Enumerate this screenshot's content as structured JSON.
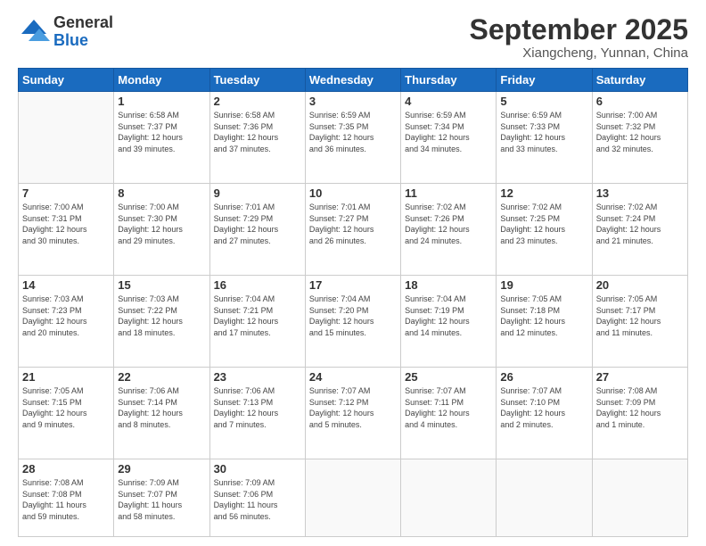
{
  "header": {
    "logo_general": "General",
    "logo_blue": "Blue",
    "title": "September 2025",
    "subtitle": "Xiangcheng, Yunnan, China"
  },
  "days_of_week": [
    "Sunday",
    "Monday",
    "Tuesday",
    "Wednesday",
    "Thursday",
    "Friday",
    "Saturday"
  ],
  "weeks": [
    [
      {
        "day": "",
        "info": ""
      },
      {
        "day": "1",
        "info": "Sunrise: 6:58 AM\nSunset: 7:37 PM\nDaylight: 12 hours\nand 39 minutes."
      },
      {
        "day": "2",
        "info": "Sunrise: 6:58 AM\nSunset: 7:36 PM\nDaylight: 12 hours\nand 37 minutes."
      },
      {
        "day": "3",
        "info": "Sunrise: 6:59 AM\nSunset: 7:35 PM\nDaylight: 12 hours\nand 36 minutes."
      },
      {
        "day": "4",
        "info": "Sunrise: 6:59 AM\nSunset: 7:34 PM\nDaylight: 12 hours\nand 34 minutes."
      },
      {
        "day": "5",
        "info": "Sunrise: 6:59 AM\nSunset: 7:33 PM\nDaylight: 12 hours\nand 33 minutes."
      },
      {
        "day": "6",
        "info": "Sunrise: 7:00 AM\nSunset: 7:32 PM\nDaylight: 12 hours\nand 32 minutes."
      }
    ],
    [
      {
        "day": "7",
        "info": "Sunrise: 7:00 AM\nSunset: 7:31 PM\nDaylight: 12 hours\nand 30 minutes."
      },
      {
        "day": "8",
        "info": "Sunrise: 7:00 AM\nSunset: 7:30 PM\nDaylight: 12 hours\nand 29 minutes."
      },
      {
        "day": "9",
        "info": "Sunrise: 7:01 AM\nSunset: 7:29 PM\nDaylight: 12 hours\nand 27 minutes."
      },
      {
        "day": "10",
        "info": "Sunrise: 7:01 AM\nSunset: 7:27 PM\nDaylight: 12 hours\nand 26 minutes."
      },
      {
        "day": "11",
        "info": "Sunrise: 7:02 AM\nSunset: 7:26 PM\nDaylight: 12 hours\nand 24 minutes."
      },
      {
        "day": "12",
        "info": "Sunrise: 7:02 AM\nSunset: 7:25 PM\nDaylight: 12 hours\nand 23 minutes."
      },
      {
        "day": "13",
        "info": "Sunrise: 7:02 AM\nSunset: 7:24 PM\nDaylight: 12 hours\nand 21 minutes."
      }
    ],
    [
      {
        "day": "14",
        "info": "Sunrise: 7:03 AM\nSunset: 7:23 PM\nDaylight: 12 hours\nand 20 minutes."
      },
      {
        "day": "15",
        "info": "Sunrise: 7:03 AM\nSunset: 7:22 PM\nDaylight: 12 hours\nand 18 minutes."
      },
      {
        "day": "16",
        "info": "Sunrise: 7:04 AM\nSunset: 7:21 PM\nDaylight: 12 hours\nand 17 minutes."
      },
      {
        "day": "17",
        "info": "Sunrise: 7:04 AM\nSunset: 7:20 PM\nDaylight: 12 hours\nand 15 minutes."
      },
      {
        "day": "18",
        "info": "Sunrise: 7:04 AM\nSunset: 7:19 PM\nDaylight: 12 hours\nand 14 minutes."
      },
      {
        "day": "19",
        "info": "Sunrise: 7:05 AM\nSunset: 7:18 PM\nDaylight: 12 hours\nand 12 minutes."
      },
      {
        "day": "20",
        "info": "Sunrise: 7:05 AM\nSunset: 7:17 PM\nDaylight: 12 hours\nand 11 minutes."
      }
    ],
    [
      {
        "day": "21",
        "info": "Sunrise: 7:05 AM\nSunset: 7:15 PM\nDaylight: 12 hours\nand 9 minutes."
      },
      {
        "day": "22",
        "info": "Sunrise: 7:06 AM\nSunset: 7:14 PM\nDaylight: 12 hours\nand 8 minutes."
      },
      {
        "day": "23",
        "info": "Sunrise: 7:06 AM\nSunset: 7:13 PM\nDaylight: 12 hours\nand 7 minutes."
      },
      {
        "day": "24",
        "info": "Sunrise: 7:07 AM\nSunset: 7:12 PM\nDaylight: 12 hours\nand 5 minutes."
      },
      {
        "day": "25",
        "info": "Sunrise: 7:07 AM\nSunset: 7:11 PM\nDaylight: 12 hours\nand 4 minutes."
      },
      {
        "day": "26",
        "info": "Sunrise: 7:07 AM\nSunset: 7:10 PM\nDaylight: 12 hours\nand 2 minutes."
      },
      {
        "day": "27",
        "info": "Sunrise: 7:08 AM\nSunset: 7:09 PM\nDaylight: 12 hours\nand 1 minute."
      }
    ],
    [
      {
        "day": "28",
        "info": "Sunrise: 7:08 AM\nSunset: 7:08 PM\nDaylight: 11 hours\nand 59 minutes."
      },
      {
        "day": "29",
        "info": "Sunrise: 7:09 AM\nSunset: 7:07 PM\nDaylight: 11 hours\nand 58 minutes."
      },
      {
        "day": "30",
        "info": "Sunrise: 7:09 AM\nSunset: 7:06 PM\nDaylight: 11 hours\nand 56 minutes."
      },
      {
        "day": "",
        "info": ""
      },
      {
        "day": "",
        "info": ""
      },
      {
        "day": "",
        "info": ""
      },
      {
        "day": "",
        "info": ""
      }
    ]
  ]
}
